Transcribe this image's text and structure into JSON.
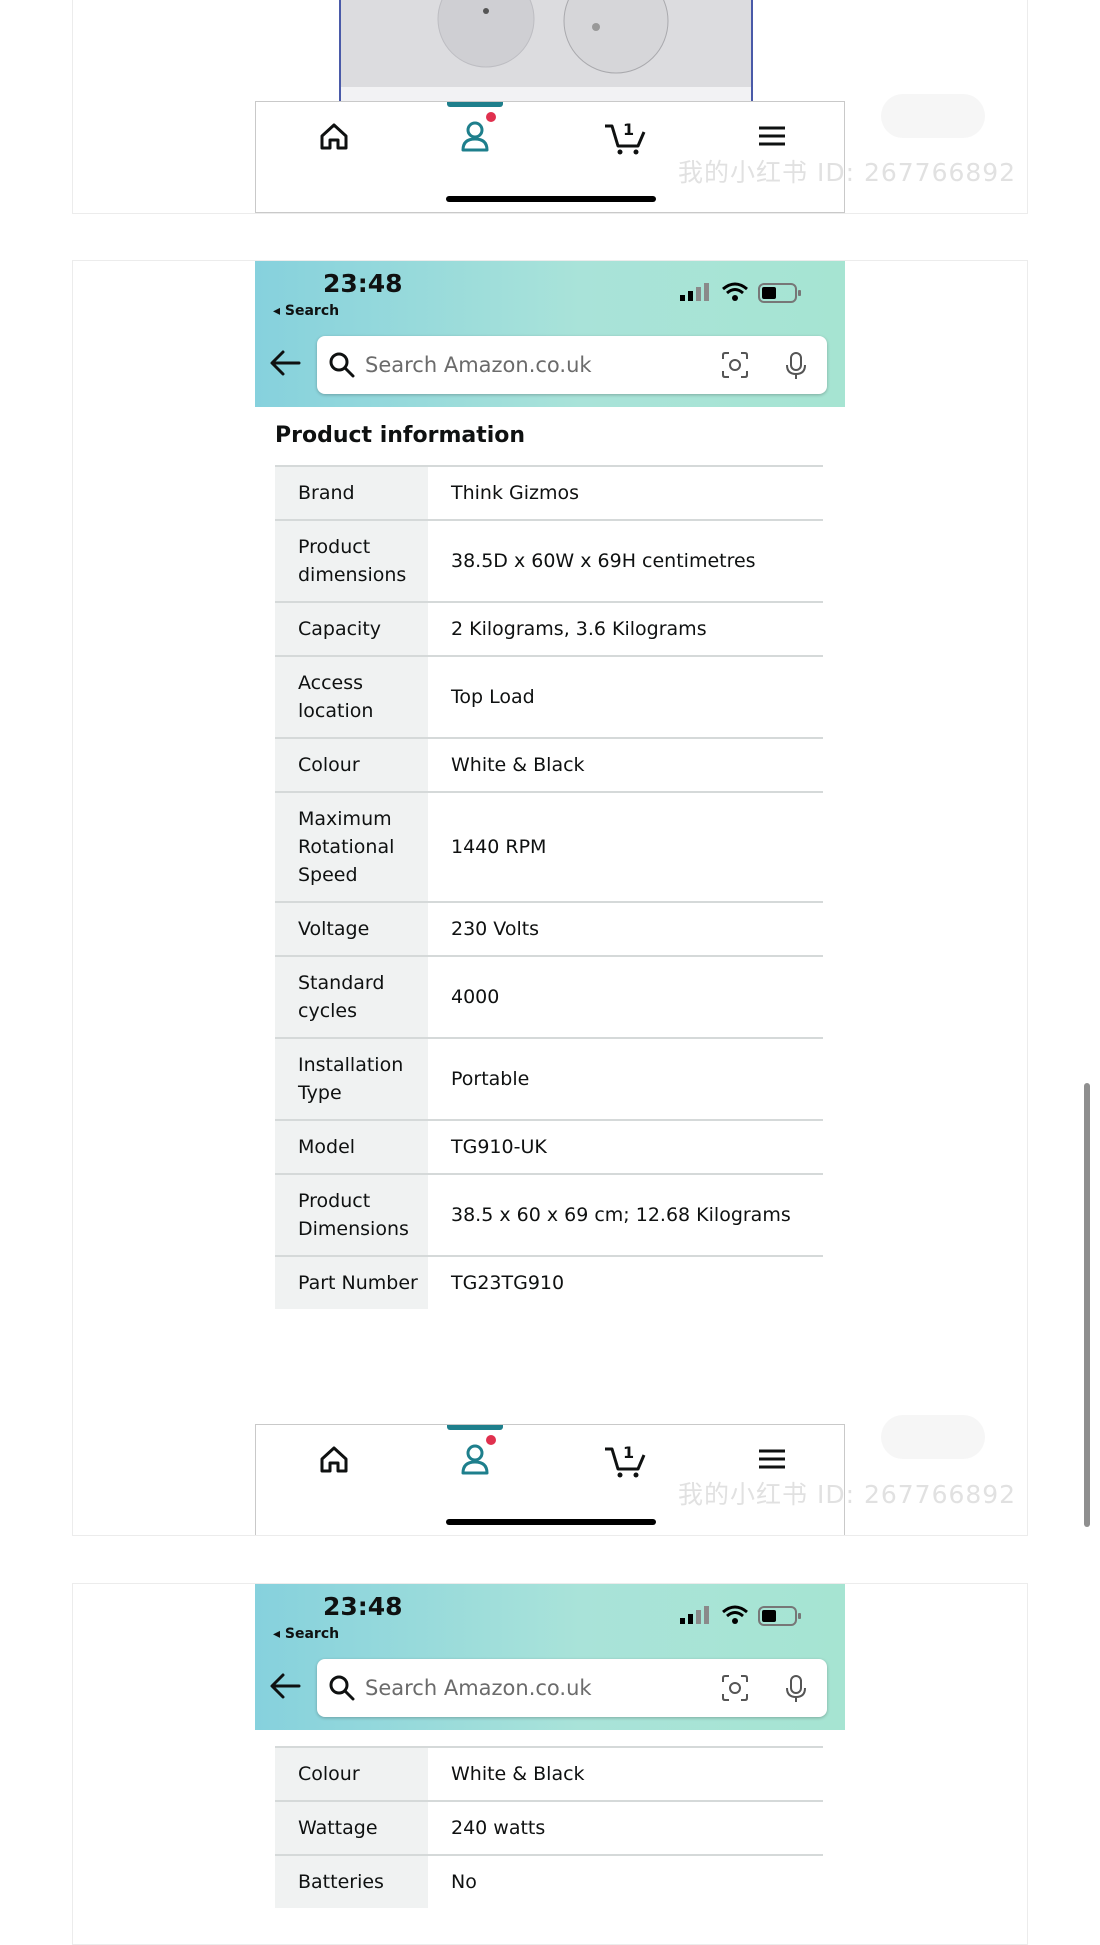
{
  "screens": [
    {
      "status": {
        "time": "23:48",
        "back_label": "◂ Search"
      },
      "search": {
        "placeholder": "Search Amazon.co.uk"
      },
      "section_title": "Product information",
      "rows": [
        {
          "key": "Brand",
          "value": "Think Gizmos"
        },
        {
          "key": "Product dimensions",
          "value": "38.5D x 60W x 69H centimetres"
        },
        {
          "key": "Capacity",
          "value": "2 Kilograms, 3.6 Kilograms"
        },
        {
          "key": "Access location",
          "value": "Top Load"
        },
        {
          "key": "Colour",
          "value": "White & Black"
        },
        {
          "key": "Maximum Rotational Speed",
          "value": "1440 RPM"
        },
        {
          "key": "Voltage",
          "value": "230 Volts"
        },
        {
          "key": "Standard cycles",
          "value": "4000"
        },
        {
          "key": "Installation Type",
          "value": "Portable"
        },
        {
          "key": "Model",
          "value": "TG910-UK"
        },
        {
          "key": "Product Dimensions",
          "value": "38.5 x 60 x 69 cm; 12.68 Kilograms"
        },
        {
          "key": "Part Number",
          "value": "TG23TG910"
        }
      ]
    },
    {
      "status": {
        "time": "23:48",
        "back_label": "◂ Search"
      },
      "search": {
        "placeholder": "Search Amazon.co.uk"
      },
      "rows": [
        {
          "key": "Colour",
          "value": "White & Black"
        },
        {
          "key": "Wattage",
          "value": "240 watts"
        },
        {
          "key": "Batteries",
          "value": "No"
        }
      ]
    }
  ],
  "tabbar": {
    "cart_count": "1"
  },
  "watermark": {
    "text": "我的小红书 ID: 267766892",
    "badge": "小红书"
  },
  "colors": {
    "accent": "#1e7f8c",
    "notification": "#e0304e",
    "header_start": "#86d1dd",
    "header_end": "#a6e4d2"
  }
}
